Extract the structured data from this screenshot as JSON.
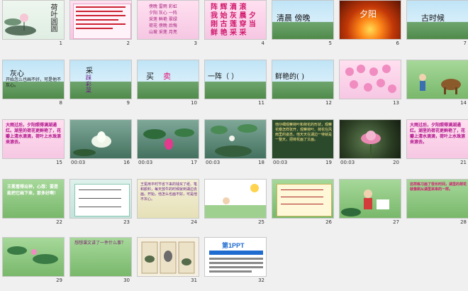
{
  "slides": [
    {
      "num": "1",
      "title": "荷叶圆圆",
      "time": ""
    },
    {
      "num": "2",
      "time": ""
    },
    {
      "num": "3",
      "chars": [
        "傍晚 雷雨 彩虹",
        "夕阳 灰心 一阵",
        "采莲 鲜艳 翠绿",
        "荷花 傍晚 后悔",
        "山坡 采莲 月亮"
      ],
      "time": ""
    },
    {
      "num": "4",
      "chars": [
        "阵 辉 滴 滚",
        "我 始 灰 晨 夕",
        "刚 古 莲 穿 当",
        "鲜 艳 采 采"
      ],
      "time": ""
    },
    {
      "num": "5",
      "text": "清晨  傍晚",
      "time": ""
    },
    {
      "num": "6",
      "text": "夕阳",
      "time": ""
    },
    {
      "num": "7",
      "text": "古时候",
      "time": ""
    },
    {
      "num": "8",
      "text": "灰心",
      "sub": "开始怎么也画不好，可是他不灰心。",
      "time": ""
    },
    {
      "num": "9",
      "text": "采",
      "sub": "踩 彩 菜",
      "time": ""
    },
    {
      "num": "10",
      "text": "买",
      "extra": "卖",
      "time": ""
    },
    {
      "num": "11",
      "text": "一阵（   ）",
      "time": ""
    },
    {
      "num": "12",
      "text": "鲜艳的(      )",
      "time": ""
    },
    {
      "num": "13",
      "time": ""
    },
    {
      "num": "14",
      "time": ""
    },
    {
      "num": "15",
      "sub": "大雨过后，夕阳照得满湖通红。湖里的荷花更鲜艳了，花瓣上清水滴滴，荷叶上水珠滚来滚去。",
      "time": ""
    },
    {
      "num": "16",
      "time": "00:03"
    },
    {
      "num": "17",
      "time": "00:03"
    },
    {
      "num": "18",
      "time": "00:03"
    },
    {
      "num": "19",
      "sub": "他仔细观察荷叶和荷花的形状，观察花瓣怎样张开，观察荷叶、荷花在风雨里的姿态，他天天在湖边一待就是一整天，把荷花画了又画。",
      "time": "00:03"
    },
    {
      "num": "20",
      "time": "00:03"
    },
    {
      "num": "21",
      "sub": "大雨过后，夕阳照得满湖通红。湖里的荷花更鲜艳了，花瓣上清水滴滴，荷叶上水珠滚来滚去。",
      "time": ""
    },
    {
      "num": "22",
      "sub": "王冕看得出神，心想：要是能把它画下来，那多好啊！",
      "time": ""
    },
    {
      "num": "23",
      "time": ""
    },
    {
      "num": "24",
      "sub": "王冕用平时节省下来的钱买了纸、笔和颜料，每天放牛的时候就到湖边去画。开始，他怎么也画不好，可是他不灰心。",
      "time": ""
    },
    {
      "num": "25",
      "time": ""
    },
    {
      "num": "26",
      "time": ""
    },
    {
      "num": "27",
      "time": ""
    },
    {
      "num": "28",
      "sub": "这样练习画了很长时间，湖里的荷花就像刚从湖里采来的一样。",
      "time": ""
    },
    {
      "num": "29",
      "time": ""
    },
    {
      "num": "30",
      "sub": "想想课文讲了一件什么事？",
      "time": ""
    },
    {
      "num": "31",
      "time": ""
    },
    {
      "num": "32",
      "brand": "第1PPT",
      "time": ""
    }
  ],
  "colors": {
    "pink": "#e2167a",
    "green": "#2e8b3a",
    "purple": "#8a2be2",
    "bg": "#f0f0f0"
  }
}
